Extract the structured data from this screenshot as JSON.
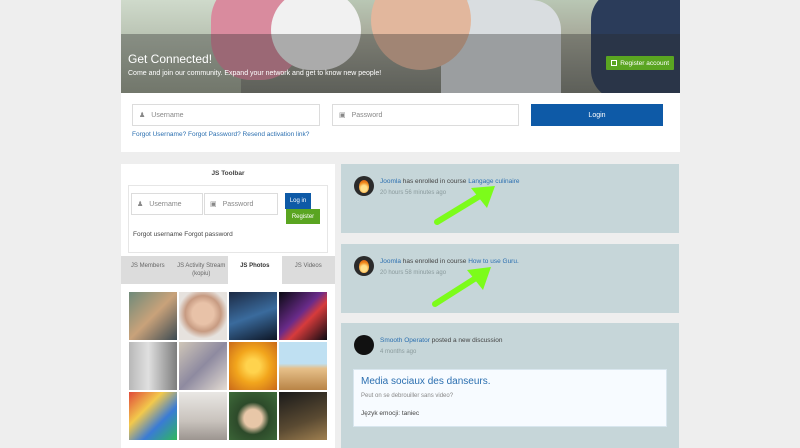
{
  "hero": {
    "title": "Get Connected!",
    "subtitle": "Come and join our community. Expand your network and get to know new people!",
    "register_account_label": "Register account"
  },
  "login": {
    "username_placeholder": "Username",
    "password_placeholder": "Password",
    "login_label": "Login",
    "forgot_text": "Forgot Username? Forgot Password? Resend activation link?"
  },
  "toolbar": {
    "title": "JS Toolbar",
    "username_placeholder": "Username",
    "password_placeholder": "Password",
    "login_label": "Log in",
    "register_label": "Register",
    "forgot_text": "Forgot username Forgot password"
  },
  "tabs": [
    {
      "label": "JS Members"
    },
    {
      "label": "JS Activity Stream (kopiu)"
    },
    {
      "label": "JS Photos"
    },
    {
      "label": "JS Videos"
    }
  ],
  "activity": [
    {
      "user": "Joomla",
      "text": " has enrolled in course ",
      "link": "Langage culinaire",
      "time": "20 hours 56 minutes ago"
    },
    {
      "user": "Joomla",
      "text": " has enrolled in course ",
      "link": "How to use Guru.",
      "time": "20 hours 58 minutes ago"
    },
    {
      "user": "Smooth Operator",
      "text": " posted a new discussion",
      "link": "",
      "time": "4 months ago",
      "post_title": "Media sociaux des danseurs.",
      "post_sub": "Peut on se debrouiller sans video?",
      "post_body": "Język emocji: taniec"
    }
  ],
  "colors": {
    "primary": "#0e5aa7",
    "success": "#5aa521",
    "activity_bg": "#c6d6d9",
    "link": "#2b6fb0",
    "arrow": "#7cfc1a"
  }
}
